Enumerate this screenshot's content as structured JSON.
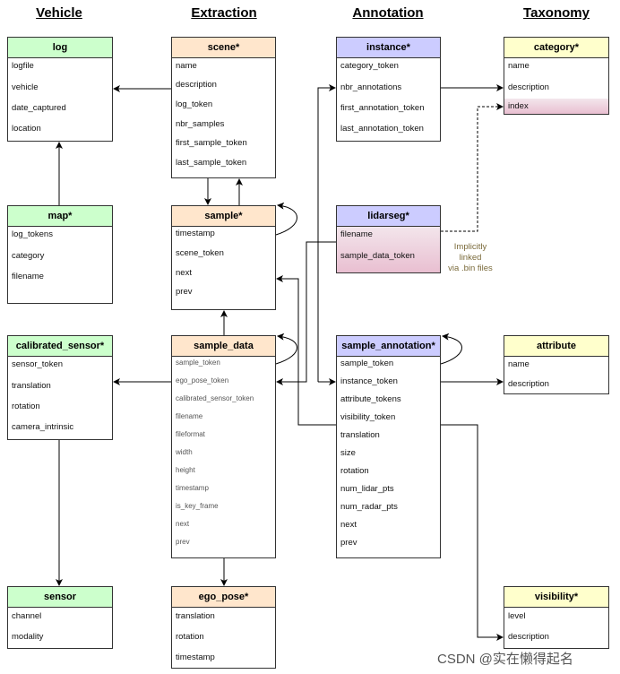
{
  "columns": [
    "Vehicle",
    "Extraction",
    "Annotation",
    "Taxonomy"
  ],
  "colors": {
    "vehicle": "#ccffcc",
    "extraction": "#ffe6cc",
    "annotation": "#ccccff",
    "taxonomy": "#ffffcc",
    "highlight": "#e9bfd1"
  },
  "tables": {
    "log": {
      "title": "log",
      "fields": [
        "logfile",
        "vehicle",
        "date_captured",
        "location"
      ]
    },
    "scene": {
      "title": "scene*",
      "fields": [
        "name",
        "description",
        "log_token",
        "nbr_samples",
        "first_sample_token",
        "last_sample_token"
      ]
    },
    "instance": {
      "title": "instance*",
      "fields": [
        "category_token",
        "nbr_annotations",
        "first_annotation_token",
        "last_annotation_token"
      ]
    },
    "category": {
      "title": "category*",
      "fields": [
        "name",
        "description",
        "index"
      ]
    },
    "map": {
      "title": "map*",
      "fields": [
        "log_tokens",
        "category",
        "filename"
      ]
    },
    "sample": {
      "title": "sample*",
      "fields": [
        "timestamp",
        "scene_token",
        "next",
        "prev"
      ]
    },
    "lidarseg": {
      "title": "lidarseg*",
      "fields": [
        "filename",
        "sample_data_token"
      ]
    },
    "calibrated_sensor": {
      "title": "calibrated_sensor*",
      "fields": [
        "sensor_token",
        "translation",
        "rotation",
        "camera_intrinsic"
      ]
    },
    "sample_data": {
      "title": "sample_data",
      "fields": [
        "sample_token",
        "ego_pose_token",
        "calibrated_sensor_token",
        "filename",
        "fileformat",
        "width",
        "height",
        "timestamp",
        "is_key_frame",
        "next",
        "prev"
      ]
    },
    "sample_annotation": {
      "title": "sample_annotation*",
      "fields": [
        "sample_token",
        "instance_token",
        "attribute_tokens",
        "visibility_token",
        "translation",
        "size",
        "rotation",
        "num_lidar_pts",
        "num_radar_pts",
        "next",
        "prev"
      ]
    },
    "attribute": {
      "title": "attribute",
      "fields": [
        "name",
        "description"
      ]
    },
    "sensor": {
      "title": "sensor",
      "fields": [
        "channel",
        "modality"
      ]
    },
    "ego_pose": {
      "title": "ego_pose*",
      "fields": [
        "translation",
        "rotation",
        "timestamp"
      ]
    },
    "visibility": {
      "title": "visibility*",
      "fields": [
        "level",
        "description"
      ]
    }
  },
  "note": [
    "Implicitly",
    "linked",
    "via .bin files"
  ],
  "watermark": "CSDN @实在懒得起名"
}
